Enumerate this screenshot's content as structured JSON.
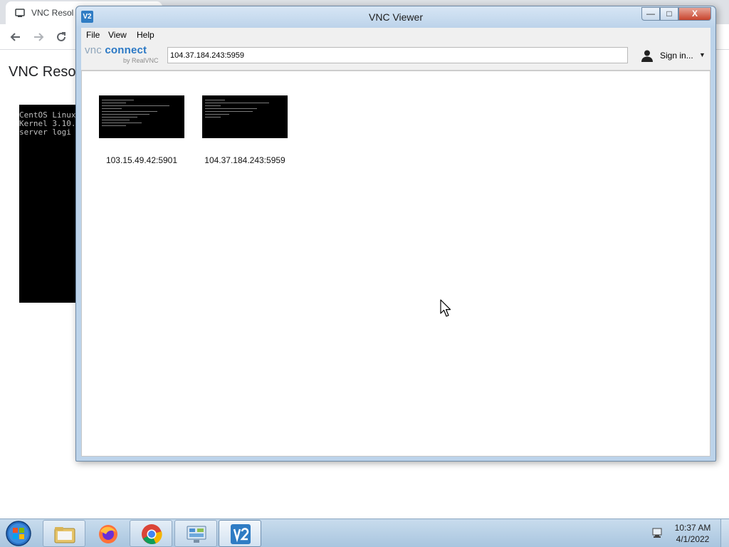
{
  "browser": {
    "tab_title": "VNC Resol",
    "page_heading": "VNC Resol",
    "terminal_lines": [
      "CentOS Linux",
      "Kernel 3.10.",
      "",
      "server logi"
    ]
  },
  "window": {
    "title": "VNC Viewer",
    "title_icon_text": "V2",
    "minimize_label": "—",
    "maximize_label": "□",
    "close_label": "X"
  },
  "menu": {
    "items": [
      {
        "label": "File"
      },
      {
        "label": "View"
      },
      {
        "label": "Help"
      }
    ]
  },
  "toolbar": {
    "logo_word1": "vnc",
    "logo_word2": "connect",
    "logo_sub": "by RealVNC",
    "search_value": "104.37.184.243:5959",
    "signin_label": "Sign in...",
    "signin_caret": "▼"
  },
  "connections": [
    {
      "label": "103.15.49.42:5901"
    },
    {
      "label": "104.37.184.243:5959"
    }
  ],
  "taskbar": {
    "apps": [
      "windows-explorer",
      "firefox",
      "chrome",
      "control-panel",
      "vnc-viewer"
    ],
    "clock_time": "10:37 AM",
    "clock_date": "4/1/2022"
  },
  "colors": {
    "accent": "#2a78c5",
    "window_frame": "#bcd3ea",
    "close_button": "#c7432c"
  }
}
